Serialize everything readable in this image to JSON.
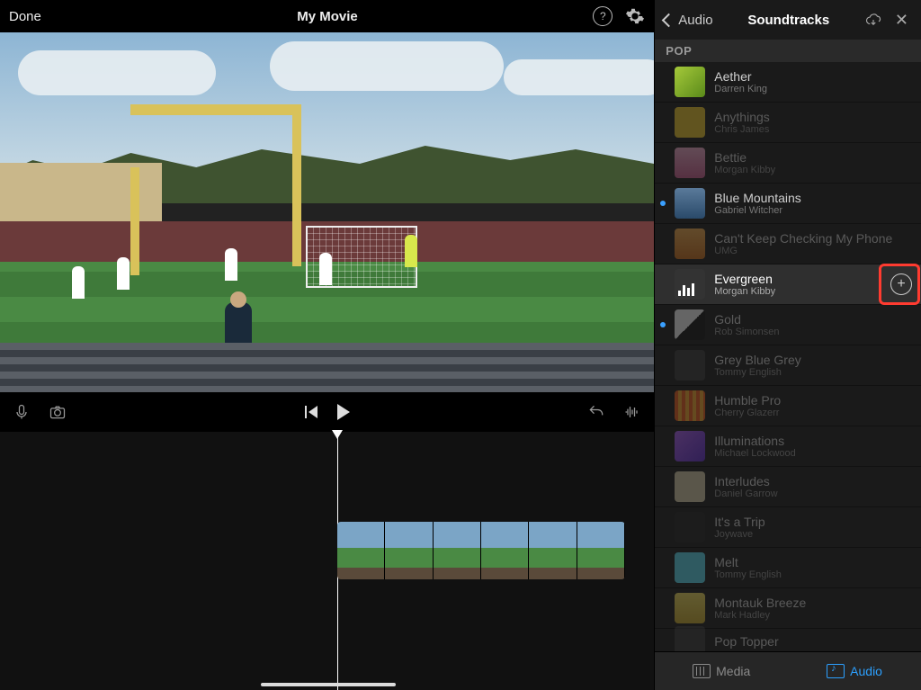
{
  "topbar": {
    "done": "Done",
    "title": "My Movie"
  },
  "panel": {
    "back": "Audio",
    "title": "Soundtracks",
    "section": "POP"
  },
  "tracks": [
    {
      "title": "Aether",
      "artist": "Darren King",
      "art": "a-green",
      "dim": false,
      "dot": false
    },
    {
      "title": "Anythings",
      "artist": "Chris James",
      "art": "a-yel",
      "dim": true,
      "dot": false
    },
    {
      "title": "Bettie",
      "artist": "Morgan Kibby",
      "art": "a-pink",
      "dim": true,
      "dot": false
    },
    {
      "title": "Blue Mountains",
      "artist": "Gabriel Witcher",
      "art": "a-blue",
      "dim": false,
      "dot": true
    },
    {
      "title": "Can't Keep Checking My Phone",
      "artist": "UMG",
      "art": "a-ora",
      "dim": true,
      "dot": false
    },
    {
      "title": "Evergreen",
      "artist": "Morgan Kibby",
      "art": "sel",
      "dim": false,
      "dot": false,
      "selected": true,
      "add": true
    },
    {
      "title": "Gold",
      "artist": "Rob Simonsen",
      "art": "a-bw",
      "dim": true,
      "dot": true
    },
    {
      "title": "Grey Blue Grey",
      "artist": "Tommy English",
      "art": "a-grey",
      "dim": true,
      "dot": false
    },
    {
      "title": "Humble Pro",
      "artist": "Cherry Glazerr",
      "art": "a-fire",
      "dim": true,
      "dot": false
    },
    {
      "title": "Illuminations",
      "artist": "Michael Lockwood",
      "art": "a-pur",
      "dim": true,
      "dot": false
    },
    {
      "title": "Interludes",
      "artist": "Daniel Garrow",
      "art": "a-bei",
      "dim": true,
      "dot": false
    },
    {
      "title": "It's a Trip",
      "artist": "Joywave",
      "art": "a-bk",
      "dim": true,
      "dot": false
    },
    {
      "title": "Melt",
      "artist": "Tommy English",
      "art": "a-cy",
      "dim": true,
      "dot": false
    },
    {
      "title": "Montauk Breeze",
      "artist": "Mark Hadley",
      "art": "a-yel2",
      "dim": true,
      "dot": false
    },
    {
      "title": "Pop Topper",
      "artist": "",
      "art": "a-grey",
      "dim": true,
      "dot": false,
      "cut": true
    }
  ],
  "tabs": {
    "media": "Media",
    "audio": "Audio"
  }
}
